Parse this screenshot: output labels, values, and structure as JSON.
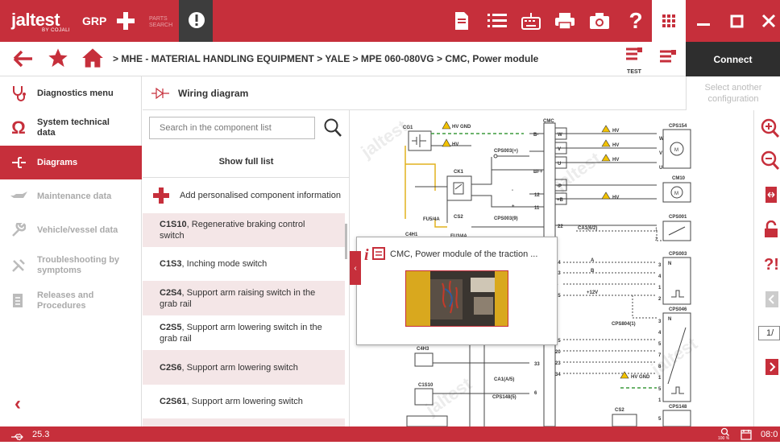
{
  "app": {
    "logo": "jaltest",
    "logo_sub": "BY COJALI",
    "grp": "GRP",
    "parts_search": "PARTS SEARCH"
  },
  "colors": {
    "brand": "#c62f3b",
    "dark": "#2e2e2e"
  },
  "topbar_icons": [
    "document-icon",
    "list-icon",
    "keyboard-icon",
    "printer-icon",
    "camera-icon",
    "help-icon",
    "grid-icon"
  ],
  "breadcrumb": "> MHE - MATERIAL HANDLING EQUIPMENT > YALE > MPE 060-080VG > CMC, Power module",
  "nav": {
    "test_label": "TEST",
    "connect": "Connect"
  },
  "sidebar": {
    "items": [
      {
        "label": "Diagnostics menu",
        "icon": "stethoscope-icon",
        "state": "normal"
      },
      {
        "label": "System technical data",
        "icon": "ohm-icon",
        "state": "normal"
      },
      {
        "label": "Diagrams",
        "icon": "diagram-icon",
        "state": "active"
      },
      {
        "label": "Maintenance data",
        "icon": "oil-can-icon",
        "state": "disabled"
      },
      {
        "label": "Vehicle/vessel data",
        "icon": "wrench-icon",
        "state": "disabled"
      },
      {
        "label": "Troubleshooting by symptoms",
        "icon": "tools-icon",
        "state": "disabled"
      },
      {
        "label": "Releases and Procedures",
        "icon": "notes-icon",
        "state": "disabled"
      }
    ]
  },
  "panel": {
    "title": "Wiring diagram",
    "config": "Select another configuration"
  },
  "list": {
    "search_placeholder": "Search in the component list",
    "show_full": "Show full list",
    "add_info": "Add personalised component information",
    "components": [
      {
        "code": "C1S10",
        "desc": ", Regenerative braking control switch"
      },
      {
        "code": "C1S3",
        "desc": ", Inching mode switch"
      },
      {
        "code": "C2S4",
        "desc": ", Support arm raising switch in the grab rail"
      },
      {
        "code": "C2S5",
        "desc": ", Support arm lowering switch in the grab rail"
      },
      {
        "code": "C2S6",
        "desc": ", Support arm lowering switch"
      },
      {
        "code": "C2S61",
        "desc": ", Support arm lowering switch"
      }
    ]
  },
  "popup": {
    "title": "CMC, Power module of the traction ..."
  },
  "diagram": {
    "labels": {
      "cg1": "CG1",
      "cmc": "CMC",
      "hv_gnd": "HV GND",
      "hv": "HV",
      "cps154": "CPS154",
      "cm10": "CM10",
      "cps001": "CPS001",
      "cps003": "CPS003",
      "cps046": "CPS046",
      "cps148": "CPS148",
      "ck1": "CK1",
      "cs2": "CS2",
      "fu5_4a": "FU5/4A",
      "c4h1": "C4H1",
      "fu3_4a": "FU3/4A",
      "cps003_9": "CPS003(9)",
      "cps003_plus": "CPS003(+)",
      "ca1_6_2": "CA1(6/2)",
      "plus12v": "+12V",
      "cps804_1": "CPS804(1)",
      "c4h3": "C4H3",
      "c1s10": "C1S10",
      "ca1_a5": "CA1(A/5)",
      "cps148_5": "CPS148(5)",
      "cs2b": "CS2",
      "w": "W",
      "v": "V",
      "u": "U",
      "b_minus": "B-",
      "bf_plus": "BF+",
      "p_minus": "-P",
      "b_plus": "+B",
      "minus": "-",
      "plus": "+",
      "a": "A",
      "b": "B",
      "n": "N",
      "m": "M",
      "watermark": "jaltest"
    },
    "pins": [
      "12",
      "11",
      "22",
      "14",
      "13",
      "5",
      "25",
      "15",
      "20",
      "23",
      "34",
      "33",
      "6",
      "1",
      "2",
      "3",
      "4",
      "1",
      "2",
      "3",
      "4",
      "5",
      "7",
      "8",
      "1",
      "5"
    ]
  },
  "right_tools": [
    "zoom-in-icon",
    "zoom-out-icon",
    "fit-icon",
    "lock-icon",
    "info-question-icon",
    "page-prev-icon",
    "page-number",
    "page-next-icon"
  ],
  "page_indicator": "1/",
  "status": {
    "usb_value": "25.3",
    "zoom": "100 %",
    "time": "08:0"
  }
}
